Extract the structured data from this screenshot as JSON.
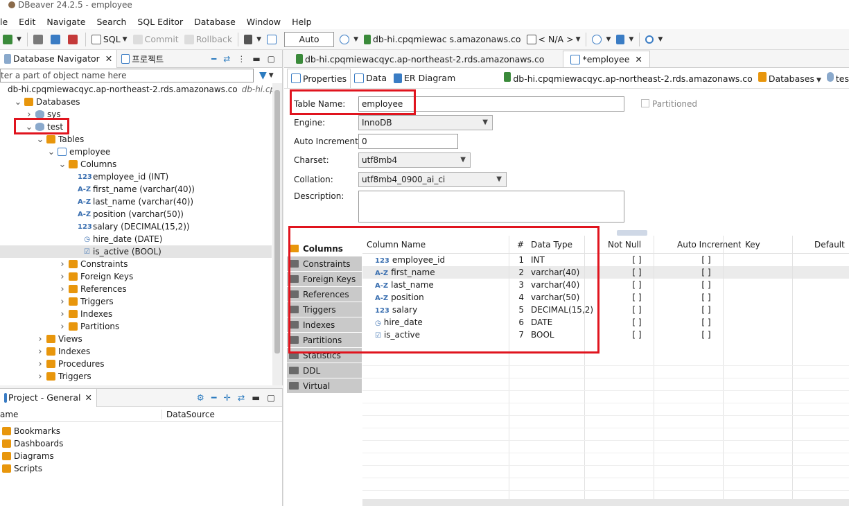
{
  "window": {
    "title": "DBeaver 24.2.5 - employee"
  },
  "menu": [
    "le",
    "Edit",
    "Navigate",
    "Search",
    "SQL Editor",
    "Database",
    "Window",
    "Help"
  ],
  "toolbar": {
    "sql_label": "SQL",
    "commit_label": "Commit",
    "rollback_label": "Rollback",
    "auto_label": "Auto",
    "connection_label": "db-hi.cpqmiewac  s.amazonaws.co",
    "schema_label": "< N/A >"
  },
  "navigator": {
    "tab_label": "Database Navigator",
    "project_tab_label": "프로젝트",
    "filter_placeholder": "ter a part of object name here",
    "tree": [
      {
        "indent": 0,
        "arrow": "",
        "icon": "conn",
        "label": "db-hi.cpqmiewacqyc.ap-northeast-2.rds.amazonaws.co",
        "extra": "db-hi.cp..."
      },
      {
        "indent": 1,
        "arrow": "v",
        "icon": "folder",
        "label": "Databases"
      },
      {
        "indent": 2,
        "arrow": ">",
        "icon": "db",
        "label": "sys"
      },
      {
        "indent": 2,
        "arrow": "v",
        "icon": "db",
        "label": "test"
      },
      {
        "indent": 3,
        "arrow": "v",
        "icon": "folder",
        "label": "Tables"
      },
      {
        "indent": 4,
        "arrow": "v",
        "icon": "table",
        "label": "employee"
      },
      {
        "indent": 5,
        "arrow": "v",
        "icon": "folder",
        "label": "Columns"
      },
      {
        "indent": 6,
        "arrow": "",
        "icon": "123",
        "label": "employee_id (INT)"
      },
      {
        "indent": 6,
        "arrow": "",
        "icon": "A-Z",
        "label": "first_name (varchar(40))"
      },
      {
        "indent": 6,
        "arrow": "",
        "icon": "A-Z",
        "label": "last_name (varchar(40))"
      },
      {
        "indent": 6,
        "arrow": "",
        "icon": "A-Z",
        "label": "position (varchar(50))"
      },
      {
        "indent": 6,
        "arrow": "",
        "icon": "123",
        "label": "salary (DECIMAL(15,2))"
      },
      {
        "indent": 6,
        "arrow": "",
        "icon": "clock",
        "label": "hire_date (DATE)"
      },
      {
        "indent": 6,
        "arrow": "",
        "icon": "check",
        "label": "is_active (BOOL)",
        "selected": true
      },
      {
        "indent": 5,
        "arrow": ">",
        "icon": "folder",
        "label": "Constraints"
      },
      {
        "indent": 5,
        "arrow": ">",
        "icon": "folder",
        "label": "Foreign Keys"
      },
      {
        "indent": 5,
        "arrow": ">",
        "icon": "folder",
        "label": "References"
      },
      {
        "indent": 5,
        "arrow": ">",
        "icon": "folder",
        "label": "Triggers"
      },
      {
        "indent": 5,
        "arrow": ">",
        "icon": "folder",
        "label": "Indexes"
      },
      {
        "indent": 5,
        "arrow": ">",
        "icon": "folder",
        "label": "Partitions"
      },
      {
        "indent": 3,
        "arrow": ">",
        "icon": "folder",
        "label": "Views"
      },
      {
        "indent": 3,
        "arrow": ">",
        "icon": "folder",
        "label": "Indexes"
      },
      {
        "indent": 3,
        "arrow": ">",
        "icon": "folder",
        "label": "Procedures"
      },
      {
        "indent": 3,
        "arrow": ">",
        "icon": "folder",
        "label": "Triggers"
      }
    ]
  },
  "project": {
    "tab_label": "Project - General",
    "col_name": "ame",
    "col_datasource": "DataSource",
    "items": [
      "Bookmarks",
      "Dashboards",
      "Diagrams",
      "Scripts"
    ]
  },
  "editor": {
    "tabs": [
      "db-hi.cpqmiewacqyc.ap-northeast-2.rds.amazonaws.co",
      "*employee"
    ],
    "subtabs": [
      "Properties",
      "Data",
      "ER Diagram"
    ],
    "crumbs": [
      "db-hi.cpqmiewacqyc.ap-northeast-2.rds.amazonaws.co",
      "Databases",
      "tes"
    ],
    "props": {
      "table_name_label": "Table Name:",
      "table_name": "employee",
      "partitioned_label": "Partitioned",
      "engine_label": "Engine:",
      "engine": "InnoDB",
      "auto_increment_label": "Auto Increment:",
      "auto_increment": "0",
      "charset_label": "Charset:",
      "charset": "utf8mb4",
      "collation_label": "Collation:",
      "collation": "utf8mb4_0900_ai_ci",
      "description_label": "Description:"
    },
    "side_tabs": [
      "Columns",
      "Constraints",
      "Foreign Keys",
      "References",
      "Triggers",
      "Indexes",
      "Partitions",
      "Statistics",
      "DDL",
      "Virtual"
    ],
    "columns_header": [
      "Column Name",
      "#",
      "Data Type",
      "Not Null",
      "Auto Increment",
      "Key",
      "Default"
    ],
    "columns": [
      {
        "icon": "123",
        "name": "employee_id",
        "num": "1",
        "type": "INT",
        "notnull": "[ ]",
        "autoinc": "[ ]"
      },
      {
        "icon": "A-Z",
        "name": "first_name",
        "num": "2",
        "type": "varchar(40)",
        "notnull": "[ ]",
        "autoinc": "[ ]"
      },
      {
        "icon": "A-Z",
        "name": "last_name",
        "num": "3",
        "type": "varchar(40)",
        "notnull": "[ ]",
        "autoinc": "[ ]"
      },
      {
        "icon": "A-Z",
        "name": "position",
        "num": "4",
        "type": "varchar(50)",
        "notnull": "[ ]",
        "autoinc": "[ ]"
      },
      {
        "icon": "123",
        "name": "salary",
        "num": "5",
        "type": "DECIMAL(15,2)",
        "notnull": "[ ]",
        "autoinc": "[ ]"
      },
      {
        "icon": "clock",
        "name": "hire_date",
        "num": "6",
        "type": "DATE",
        "notnull": "[ ]",
        "autoinc": "[ ]"
      },
      {
        "icon": "check",
        "name": "is_active",
        "num": "7",
        "type": "BOOL",
        "notnull": "[ ]",
        "autoinc": "[ ]"
      }
    ]
  },
  "colors": {
    "highlight": "#e0141e",
    "folder": "#e8960c",
    "accent": "#2c7bbf"
  }
}
